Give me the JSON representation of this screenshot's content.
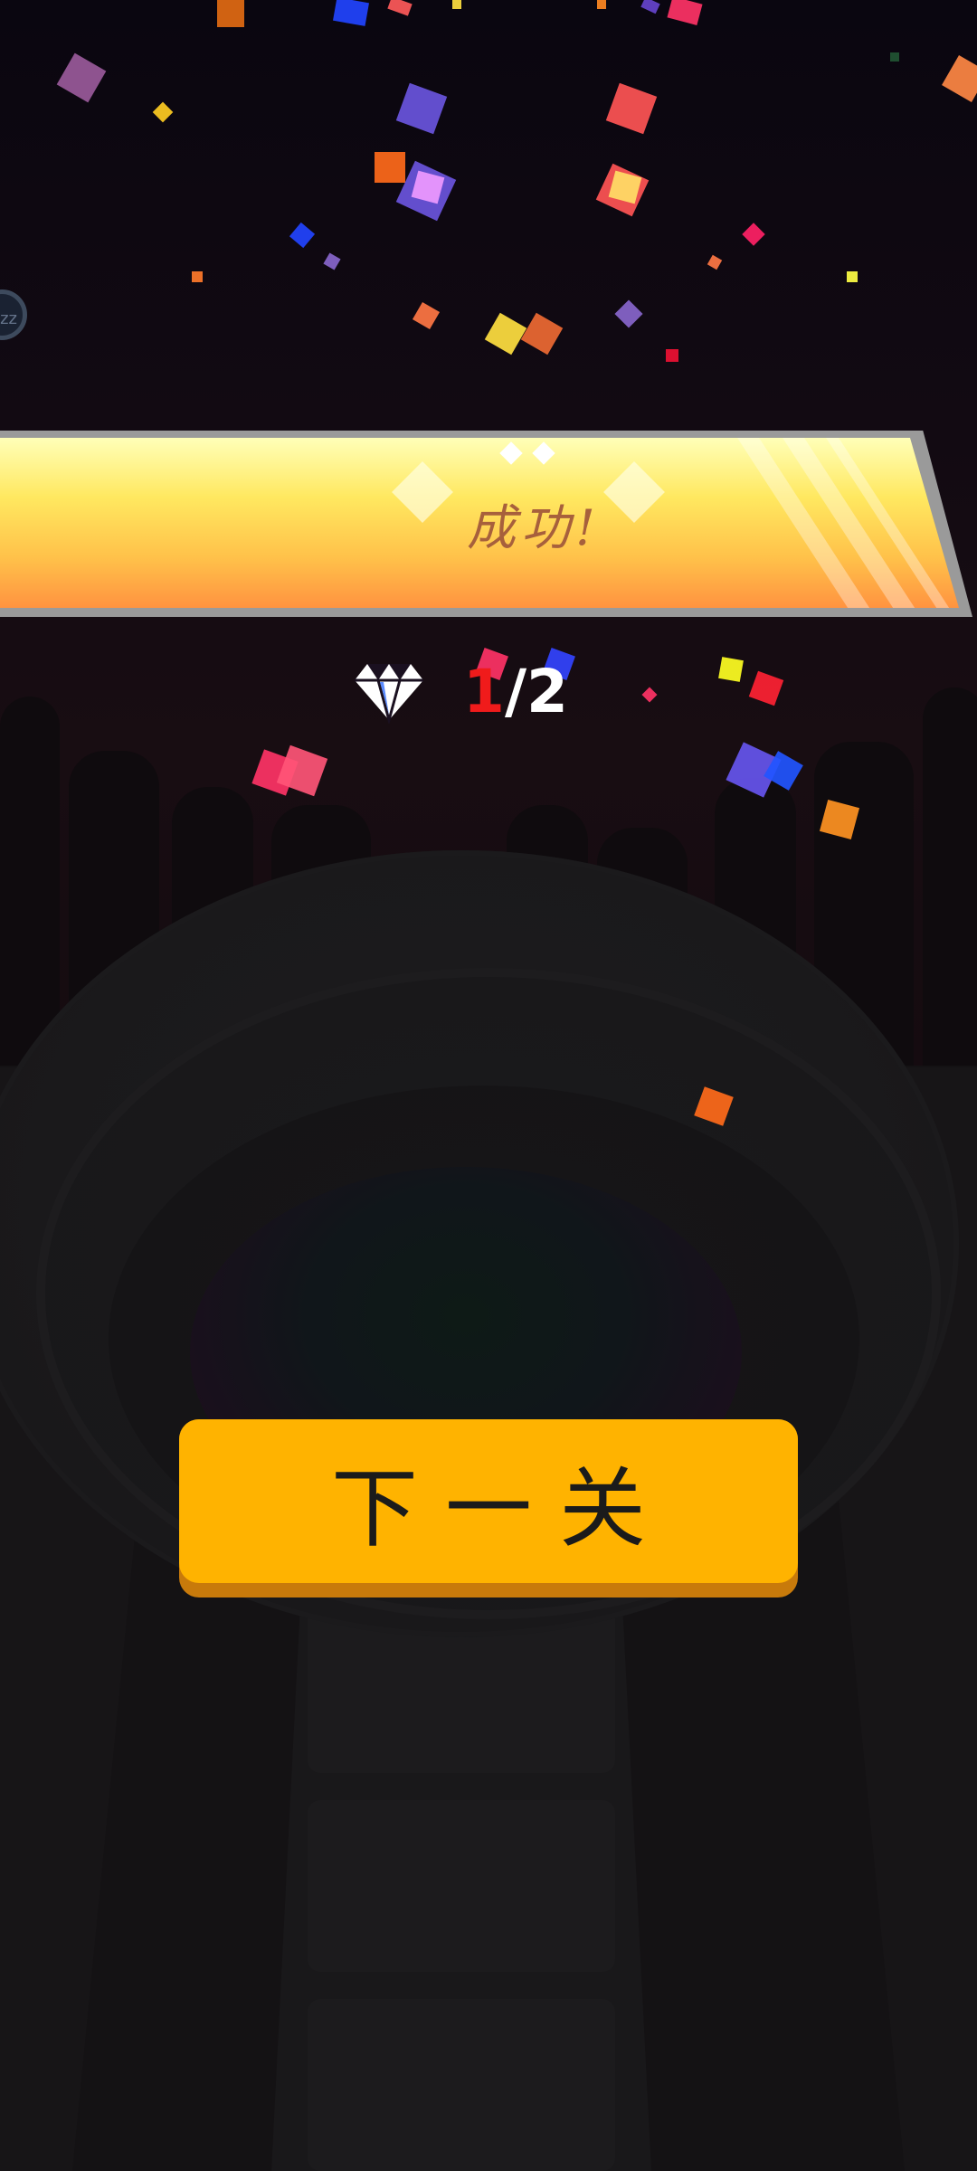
{
  "banner": {
    "title": "成功!"
  },
  "gems": {
    "icon": "diamond-icon",
    "collected": "1",
    "separator": "/",
    "total": "2",
    "collected_color": "#f01b1b"
  },
  "next_button": {
    "label": "下一关",
    "color": "#ffb300"
  },
  "side_button": {
    "icon": "snooze-icon",
    "label": "zz"
  },
  "colors": {
    "banner_top": "#ffffb8",
    "banner_bottom": "#ff9340",
    "background": "#0c0710"
  }
}
